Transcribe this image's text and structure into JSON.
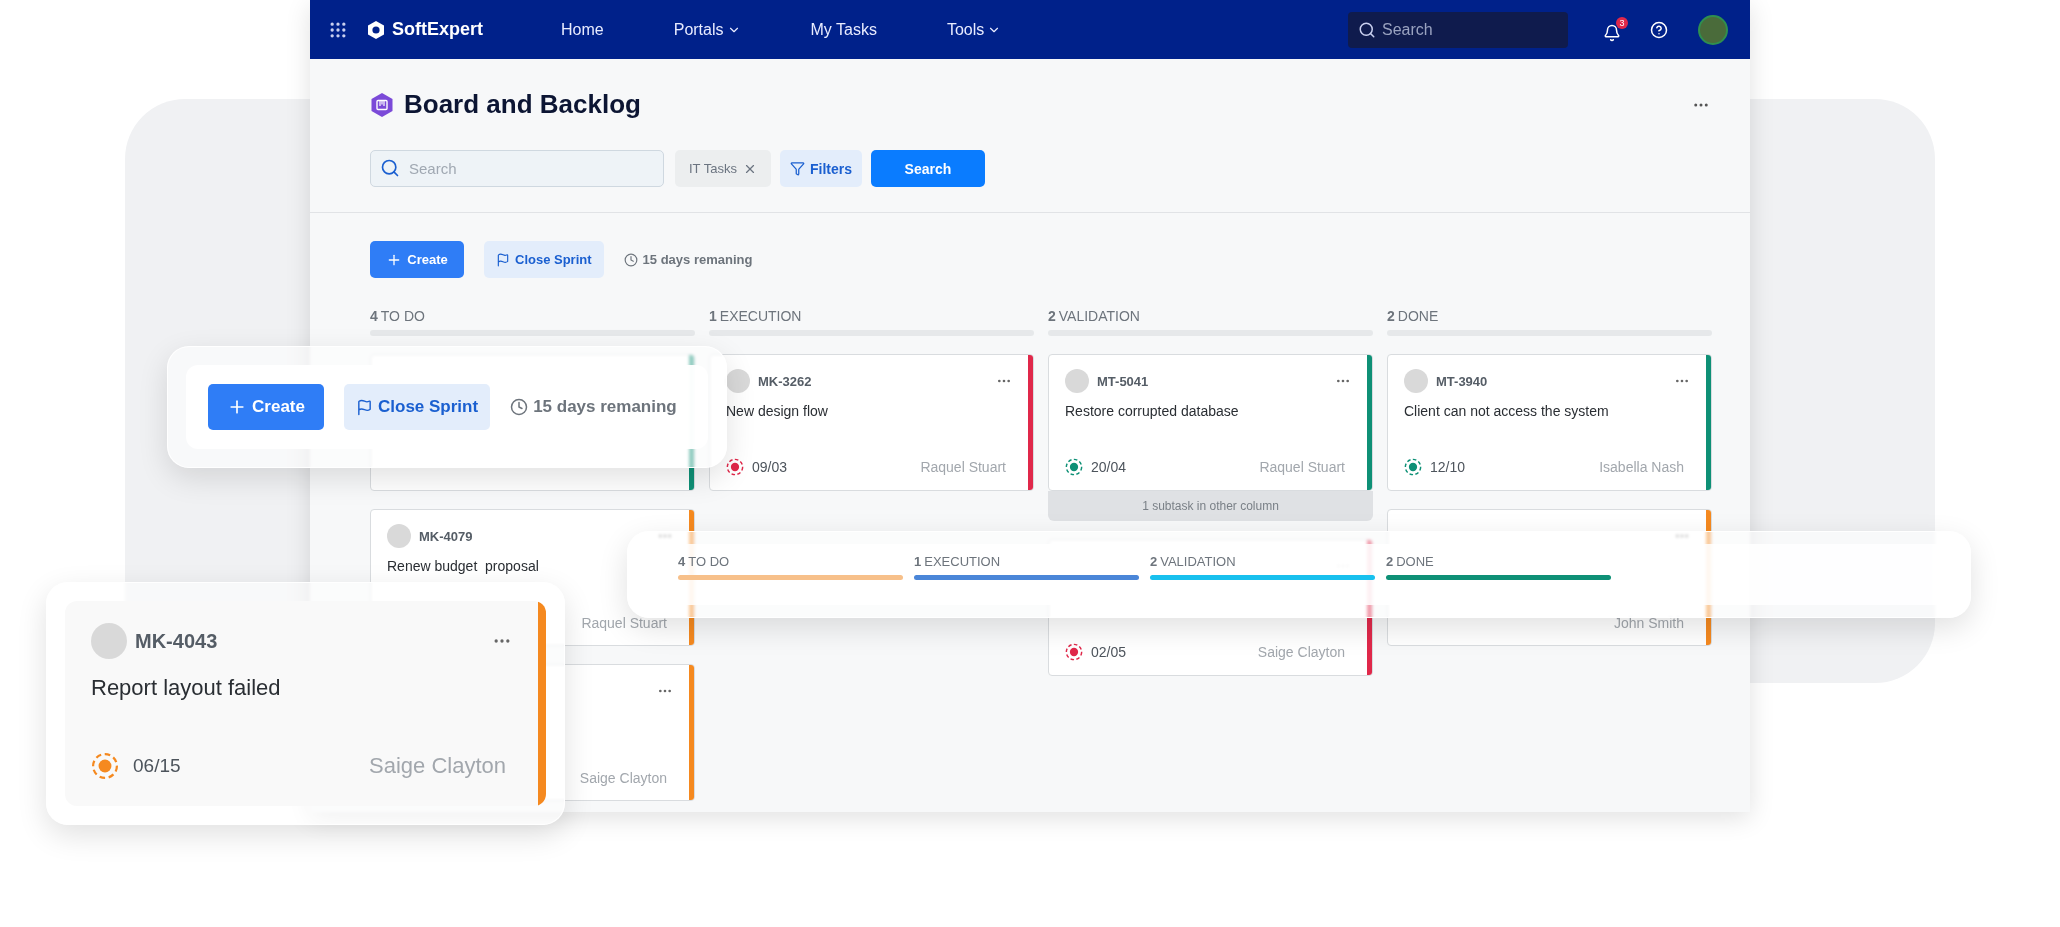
{
  "navbar": {
    "logo": "SoftExpert",
    "items": [
      {
        "label": "Home",
        "dropdown": false
      },
      {
        "label": "Portals",
        "dropdown": true
      },
      {
        "label": "My Tasks",
        "dropdown": false
      },
      {
        "label": "Tools",
        "dropdown": true
      }
    ],
    "search": {
      "placeholder": "Search"
    },
    "notifications": "3"
  },
  "page": {
    "title": "Board and Backlog",
    "search": {
      "placeholder": "Search"
    },
    "filter_chip": "IT Tasks",
    "filters_button": "Filters",
    "search_button": "Search"
  },
  "sprint": {
    "create": "Create",
    "close": "Close Sprint",
    "remaining": "15 days remaning"
  },
  "columns": [
    {
      "count": "4",
      "name": "TO DO",
      "cards": [
        {
          "color": "#0e9076"
        },
        {
          "id": "MK-4079",
          "title": "Renew budget  proposal",
          "assignee": "Raquel Stuart",
          "color": "#f5891f"
        },
        {
          "assignee": "Saige Clayton",
          "color": "#f5891f"
        }
      ]
    },
    {
      "count": "1",
      "name": "EXECUTION",
      "cards": [
        {
          "id": "MK-3262",
          "title": "New design flow",
          "date": "09/03",
          "assignee": "Raquel Stuart",
          "color": "#e0284a"
        }
      ]
    },
    {
      "count": "2",
      "name": "VALIDATION",
      "cards": [
        {
          "id": "MT-5041",
          "title": "Restore corrupted database",
          "date": "20/04",
          "assignee": "Raquel Stuart",
          "color": "#0e9076",
          "subtask": "1 subtask in other column"
        },
        {
          "date": "02/05",
          "assignee": "Saige Clayton",
          "color": "#e0284a"
        }
      ]
    },
    {
      "count": "2",
      "name": "DONE",
      "cards": [
        {
          "id": "MT-3940",
          "title": "Client can not access the system",
          "date": "12/10",
          "assignee": "Isabella Nash",
          "color": "#0e9076"
        },
        {
          "assignee": "John Smith",
          "color": "#f5891f"
        }
      ]
    }
  ],
  "callouts": {
    "sprint": {
      "create": "Create",
      "close": "Close Sprint",
      "remaining": "15 days remaning"
    },
    "columns": [
      {
        "count": "4",
        "name": "TO DO",
        "color": "#f7c08a"
      },
      {
        "count": "1",
        "name": "EXECUTION",
        "color": "#4a86d8"
      },
      {
        "count": "2",
        "name": "VALIDATION",
        "color": "#18c0ee"
      },
      {
        "count": "2",
        "name": "DONE",
        "color": "#0e9076"
      }
    ],
    "card": {
      "id": "MK-4043",
      "title": "Report layout failed",
      "date": "06/15",
      "assignee": "Saige Clayton",
      "color": "#f5891f"
    }
  }
}
